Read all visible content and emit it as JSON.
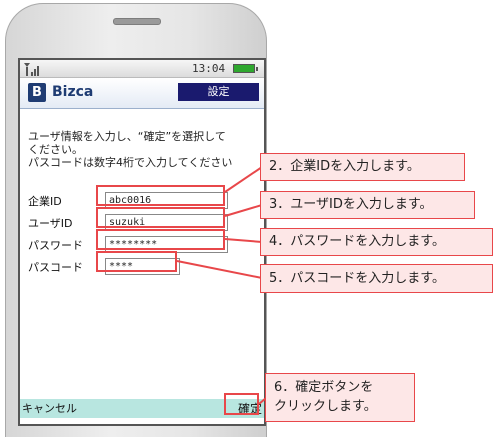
{
  "status": {
    "time": "13:04"
  },
  "app": {
    "logo_mark": "B",
    "logo_text": "Bizca",
    "settings_label": "設定"
  },
  "instructions": {
    "line1": "ユーザ情報を入力し、“確定”を選択して",
    "line2": "ください。",
    "line3": "パスコードは数字4桁で入力してください"
  },
  "form": {
    "company_id": {
      "label": "企業ID",
      "value": "abc0016"
    },
    "user_id": {
      "label": "ユーザID",
      "value": "suzuki"
    },
    "password": {
      "label": "パスワード",
      "value": "********"
    },
    "passcode": {
      "label": "パスコード",
      "value": "****"
    }
  },
  "softkeys": {
    "cancel": "キャンセル",
    "confirm": "確定"
  },
  "callouts": {
    "c2": "2．企業IDを入力します。",
    "c3": "3．ユーザIDを入力します。",
    "c4": "4．パスワードを入力します。",
    "c5": "5．パスコードを入力します。",
    "c6_line1": "6．確定ボタンを",
    "c6_line2": "クリックします。"
  },
  "colors": {
    "highlight": "#e8474a",
    "callout_bg": "#fde7e7",
    "softbar": "#b8e6e0",
    "header": "#1a1a6e"
  }
}
